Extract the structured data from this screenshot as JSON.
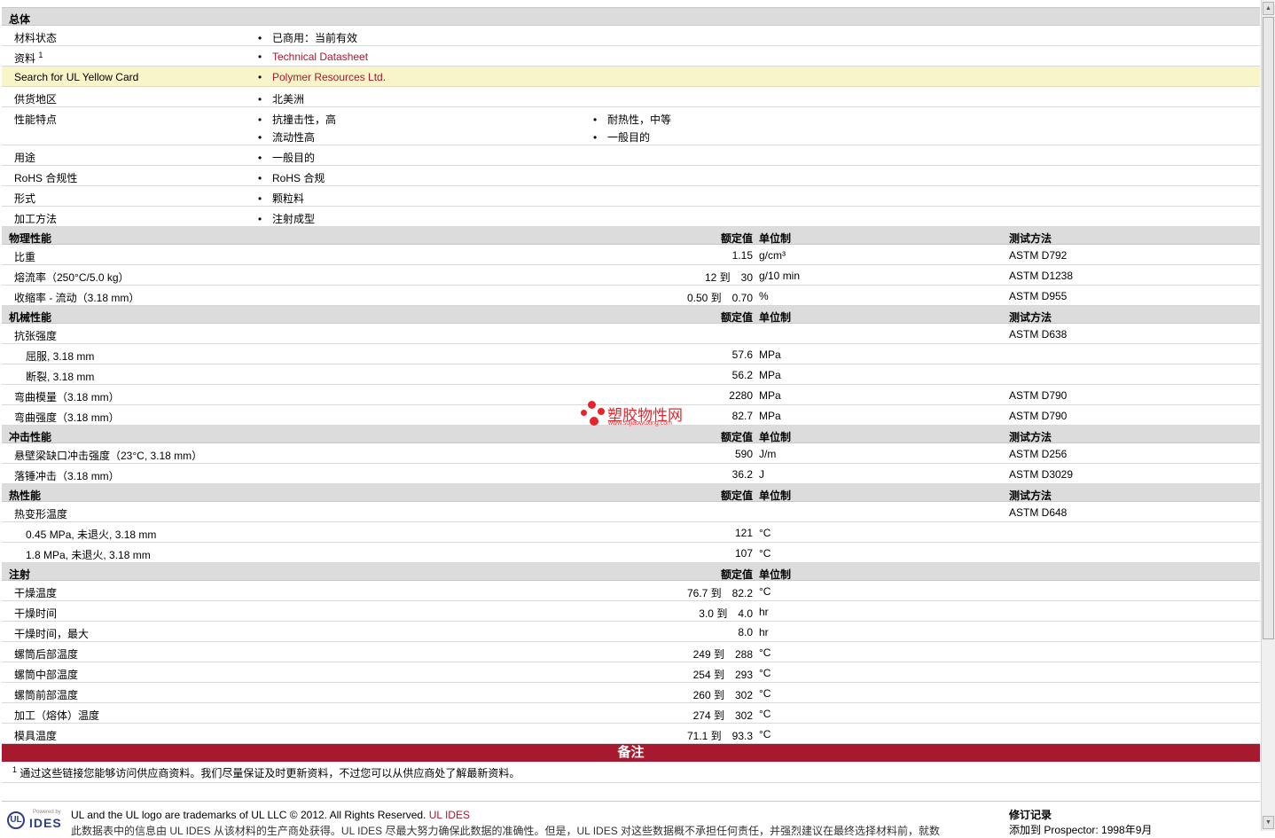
{
  "general": {
    "title": "总体",
    "rows": [
      {
        "label": "材料状态",
        "value": "已商用：当前有效"
      },
      {
        "label": "资料",
        "sup": "1",
        "value": "Technical Datasheet"
      },
      {
        "label": "Search for UL Yellow Card",
        "value": "Polymer Resources Ltd."
      },
      {
        "label": "供货地区",
        "value": "北美洲"
      },
      {
        "label": "性能特点",
        "values": [
          "抗撞击性，高",
          "耐热性，中等",
          "流动性高",
          "一般目的"
        ]
      },
      {
        "label": "用途",
        "value": "一般目的"
      },
      {
        "label": "RoHS 合规性",
        "value": "RoHS 合规"
      },
      {
        "label": "形式",
        "value": "颗粒料"
      },
      {
        "label": "加工方法",
        "value": "注射成型"
      }
    ]
  },
  "columns": {
    "nominal": "额定值",
    "unit": "单位制",
    "test": "测试方法"
  },
  "physical": {
    "title": "物理性能",
    "rows": [
      {
        "label": "比重",
        "value": "1.15",
        "unit": "g/cm³",
        "test": "ASTM D792"
      },
      {
        "label": "熔流率（250°C/5.0 kg）",
        "value": "12 到　30",
        "unit": "g/10 min",
        "test": "ASTM D1238"
      },
      {
        "label": "收缩率 - 流动（3.18 mm）",
        "value": "0.50 到　0.70",
        "unit": "%",
        "test": "ASTM D955"
      }
    ]
  },
  "mechanical": {
    "title": "机械性能",
    "rows": [
      {
        "label": "抗张强度",
        "value": "",
        "unit": "",
        "test": "ASTM D638"
      },
      {
        "label": "屈服, 3.18 mm",
        "value": "57.6",
        "unit": "MPa",
        "test": ""
      },
      {
        "label": "断裂, 3.18 mm",
        "value": "56.2",
        "unit": "MPa",
        "test": ""
      },
      {
        "label": "弯曲模量（3.18 mm）",
        "value": "2280",
        "unit": "MPa",
        "test": "ASTM D790"
      },
      {
        "label": "弯曲强度（3.18 mm）",
        "value": "82.7",
        "unit": "MPa",
        "test": "ASTM D790"
      }
    ]
  },
  "impact": {
    "title": "冲击性能",
    "rows": [
      {
        "label": "悬壁梁缺口冲击强度（23°C, 3.18 mm）",
        "value": "590",
        "unit": "J/m",
        "test": "ASTM D256"
      },
      {
        "label": "落锤冲击（3.18 mm）",
        "value": "36.2",
        "unit": "J",
        "test": "ASTM D3029"
      }
    ]
  },
  "thermal": {
    "title": "热性能",
    "rows": [
      {
        "label": "热变形温度",
        "value": "",
        "unit": "",
        "test": "ASTM D648"
      },
      {
        "label": "0.45 MPa, 未退火, 3.18 mm",
        "value": "121",
        "unit": "°C",
        "test": ""
      },
      {
        "label": "1.8 MPa, 未退火, 3.18 mm",
        "value": "107",
        "unit": "°C",
        "test": ""
      }
    ]
  },
  "injection": {
    "title": "注射",
    "rows": [
      {
        "label": "干燥温度",
        "value": "76.7 到　82.2",
        "unit": "°C"
      },
      {
        "label": "干燥时间",
        "value": "3.0 到　4.0",
        "unit": "hr"
      },
      {
        "label": "干燥时间，最大",
        "value": "8.0",
        "unit": "hr"
      },
      {
        "label": "螺筒后部温度",
        "value": "249 到　288",
        "unit": "°C"
      },
      {
        "label": "螺筒中部温度",
        "value": "254 到　293",
        "unit": "°C"
      },
      {
        "label": "螺筒前部温度",
        "value": "260 到　302",
        "unit": "°C"
      },
      {
        "label": "加工（熔体）温度",
        "value": "274 到　302",
        "unit": "°C"
      },
      {
        "label": "模具温度",
        "value": "71.1 到　93.3",
        "unit": "°C"
      }
    ]
  },
  "notes": {
    "title": "备注",
    "sup": "1",
    "text": "通过这些链接您能够访问供应商资料。我们尽量保证及时更新资料，不过您可以从供应商处了解最新资料。"
  },
  "footer": {
    "logo_ul": "UL",
    "logo_powered": "Powered by",
    "logo_ides": "IDES",
    "trademark": "UL and the UL logo are trademarks of UL LLC © 2012. All Rights Reserved.",
    "ul_ides_link": "UL IDES",
    "disclaimer": "此数据表中的信息由 UL IDES 从该材料的生产商处获得。UL IDES 尽最大努力确保此数据的准确性。但是，UL IDES 对这些数据概不承担任何责任，并强烈建议在最终选择材料前，就数",
    "rev_title": "修订记录",
    "rev_text": "添加到 Prospector: 1998年9月"
  },
  "watermark": {
    "cn": "塑胶物性网",
    "url": "www.sujiaowuxing.com",
    "color": "#e8242b"
  },
  "colors": {
    "link": "#a6192e",
    "highlight_row": "#f8f5c9",
    "header_bg": "#dcdcdc",
    "notes_bar": "#a6192e"
  }
}
